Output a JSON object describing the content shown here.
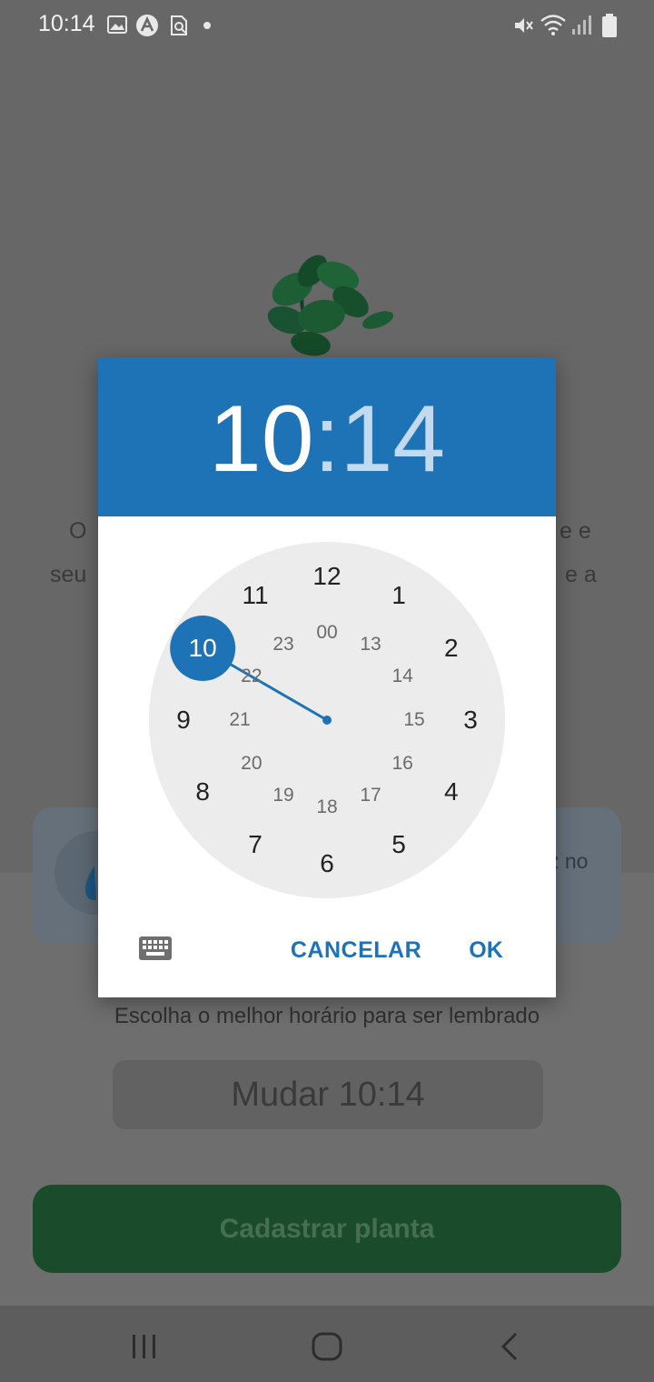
{
  "status_bar": {
    "time": "10:14",
    "left_icons": [
      "image-icon",
      "app-a-icon",
      "search-doc-icon",
      "dot-icon"
    ],
    "right_icons": [
      "mute-icon",
      "wifi-icon",
      "signal-icon",
      "battery-icon"
    ]
  },
  "background": {
    "description_left_1": "O",
    "description_right_1": "e e",
    "description_left_2": "seu",
    "description_right_2": "e a",
    "tip_right_text": "z no",
    "reminder_label": "Escolha o melhor horário para ser lembrado",
    "change_time_button": "Mudar 10:14",
    "register_button": "Cadastrar planta"
  },
  "dialog": {
    "hour": "10",
    "separator": ":",
    "minute": "14",
    "selected_hour": "10",
    "outer_numbers": [
      "12",
      "1",
      "2",
      "3",
      "4",
      "5",
      "6",
      "7",
      "8",
      "9",
      "10",
      "11"
    ],
    "inner_numbers": [
      "00",
      "13",
      "14",
      "15",
      "16",
      "17",
      "18",
      "19",
      "20",
      "21",
      "22",
      "23"
    ],
    "cancel_label": "CANCELAR",
    "ok_label": "OK",
    "keyboard_icon": "keyboard-icon"
  },
  "colors": {
    "accent": "#1e73b6",
    "dim_overlay": "#676767",
    "clock_face": "#ececec",
    "plant_button": "#1a4c2c"
  },
  "nav_bar": {
    "icons": [
      "recent-apps-icon",
      "home-icon",
      "back-icon"
    ]
  }
}
